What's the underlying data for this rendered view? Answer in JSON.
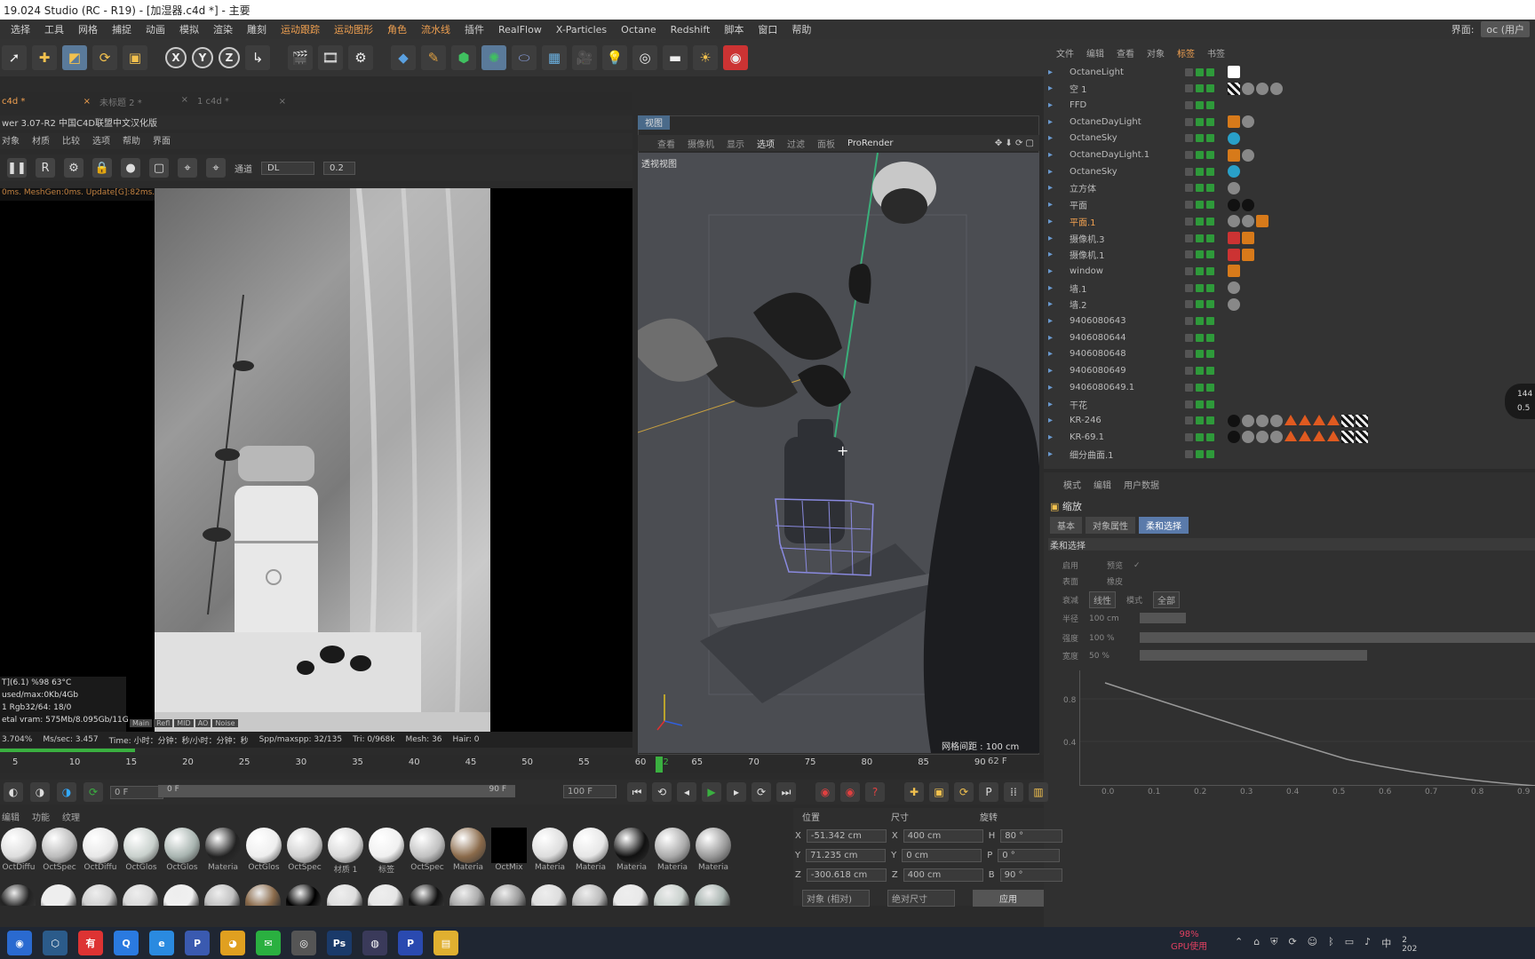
{
  "window": {
    "title": "19.024 Studio (RC - R19) - [加湿器.c4d *] - 主要"
  },
  "menu": {
    "items": [
      "选择",
      "工具",
      "网格",
      "捕捉",
      "动画",
      "模拟",
      "渲染",
      "雕刻",
      "运动跟踪",
      "运动图形",
      "角色",
      "流水线",
      "插件",
      "RealFlow",
      "X-Particles",
      "Octane",
      "Redshift",
      "脚本",
      "窗口",
      "帮助"
    ],
    "right_label": "界面:",
    "right_value": "oc (用户"
  },
  "tabs": [
    {
      "label": "c4d *"
    },
    {
      "label": "未标题 2 *"
    },
    {
      "label": "1 c4d *"
    }
  ],
  "live_viewer": {
    "title": "wer 3.07-R2 中国C4D联盟中文汉化版",
    "menu": [
      "对象",
      "材质",
      "比较",
      "选项",
      "帮助",
      "界面"
    ],
    "channel_label": "通道",
    "channel_value": "DL",
    "channel_amount": "0.2",
    "status_line": "0ms. MeshGen:0ms. Update[G]:82ms. Nodes:4? Moves:8? Matmove:0(0)",
    "info": [
      "T](6.1)      %98    63°C",
      "used/max:0Kb/4Gb",
      "1           Rgb32/64: 18/0",
      "etal vram: 575Mb/8.095Gb/11G"
    ],
    "tabs": [
      "Main",
      "Refl",
      "MID",
      "AO",
      "Noise"
    ],
    "footer": {
      "progress": "3.704%",
      "ms_sec": "Ms/sec: 3.457",
      "time": "Time: 小时：分钟：秒/小时：分钟：秒",
      "spp": "Spp/maxspp: 32/135",
      "tri": "Tri: 0/968k",
      "mesh": "Mesh: 36",
      "hair": "Hair: 0"
    }
  },
  "viewport": {
    "header": "视图",
    "menu": [
      "查看",
      "摄像机",
      "显示",
      "选项",
      "过滤",
      "面板",
      "ProRender"
    ],
    "label": "透视视图",
    "grid_spacing": "网格间距 : 100 cm"
  },
  "object_manager": {
    "menu": [
      "文件",
      "编辑",
      "查看",
      "对象",
      "标签",
      "书签"
    ],
    "objects": [
      {
        "name": "OctaneLight",
        "hl": false,
        "tags": [
          "w"
        ]
      },
      {
        "name": "空 1",
        "hl": false,
        "tags": [
          "ck",
          "s",
          "s",
          "s"
        ]
      },
      {
        "name": "FFD",
        "hl": false,
        "tags": []
      },
      {
        "name": "OctaneDayLight",
        "hl": false,
        "tags": [
          "o",
          "s"
        ]
      },
      {
        "name": "OctaneSky",
        "hl": false,
        "tags": [
          "cy"
        ]
      },
      {
        "name": "OctaneDayLight.1",
        "hl": false,
        "tags": [
          "o",
          "s"
        ]
      },
      {
        "name": "OctaneSky",
        "hl": false,
        "tags": [
          "cy"
        ]
      },
      {
        "name": "立方体",
        "hl": false,
        "tags": [
          "s"
        ]
      },
      {
        "name": "平面",
        "hl": false,
        "tags": [
          "b",
          "b"
        ]
      },
      {
        "name": "平面.1",
        "hl": true,
        "tags": [
          "s",
          "s",
          "o"
        ]
      },
      {
        "name": "摄像机.3",
        "hl": false,
        "tags": [
          "ri",
          "o"
        ]
      },
      {
        "name": "摄像机.1",
        "hl": false,
        "tags": [
          "ri",
          "o"
        ]
      },
      {
        "name": "window",
        "hl": false,
        "tags": [
          "o"
        ]
      },
      {
        "name": "墙.1",
        "hl": false,
        "tags": [
          "s"
        ]
      },
      {
        "name": "墙.2",
        "hl": false,
        "tags": [
          "s"
        ]
      },
      {
        "name": "9406080643",
        "hl": false,
        "tags": []
      },
      {
        "name": "9406080644",
        "hl": false,
        "tags": []
      },
      {
        "name": "9406080648",
        "hl": false,
        "tags": []
      },
      {
        "name": "9406080649",
        "hl": false,
        "tags": []
      },
      {
        "name": "9406080649.1",
        "hl": false,
        "tags": []
      },
      {
        "name": "干花",
        "hl": false,
        "tags": []
      },
      {
        "name": "KR-246",
        "hl": false,
        "tags": [
          "b",
          "s",
          "s",
          "s",
          "tri",
          "tri",
          "tri",
          "tri",
          "ck",
          "ck"
        ]
      },
      {
        "name": "KR-69.1",
        "hl": false,
        "tags": [
          "b",
          "s",
          "s",
          "s",
          "tri",
          "tri",
          "tri",
          "tri",
          "ck",
          "ck"
        ]
      },
      {
        "name": "细分曲面.1",
        "hl": false,
        "tags": []
      }
    ]
  },
  "attributes": {
    "menu": [
      "模式",
      "编辑",
      "用户数据"
    ],
    "title": "缩放",
    "tabs": [
      "基本",
      "对象属性",
      "柔和选择"
    ],
    "section": "柔和选择",
    "rows": [
      {
        "a": "启用",
        "b": "预览"
      },
      {
        "a": "表面",
        "b": "橡皮"
      },
      {
        "a": "限制",
        "b": ""
      },
      {
        "a": "衰减",
        "b": "线性"
      },
      {
        "a": "半径",
        "b": "100 cm"
      },
      {
        "a": "强度",
        "b": "100 %"
      },
      {
        "a": "宽度",
        "b": "50 %"
      }
    ],
    "mode_label": "模式",
    "mode_value": "全部",
    "graph_y": [
      "0.8",
      "0.4"
    ],
    "graph_x": [
      "0.0",
      "0.1",
      "0.2",
      "0.3",
      "0.4",
      "0.5",
      "0.6",
      "0.7",
      "0.8",
      "0.9"
    ]
  },
  "timeline": {
    "ticks": [
      "5",
      "10",
      "15",
      "20",
      "25",
      "30",
      "35",
      "40",
      "45",
      "50",
      "55",
      "60",
      "62",
      "65",
      "70",
      "75",
      "80",
      "85",
      "90"
    ],
    "end_label": "62 F",
    "current": "0 F",
    "range_start": "0 F",
    "range_end": "90 F",
    "max": "100 F"
  },
  "materials": {
    "menu": [
      "编辑",
      "功能",
      "纹理"
    ],
    "names": [
      "OctDiffu",
      "OctSpec",
      "OctDiffu",
      "OctGlos",
      "OctGlos",
      "Materia",
      "OctGlos",
      "OctSpec",
      "材质 1",
      "标签",
      "OctSpec",
      "Materia",
      "OctMix",
      "Materia",
      "Materia",
      "Materia",
      "Materia",
      "Materia"
    ]
  },
  "coords": {
    "headers": [
      "位置",
      "尺寸",
      "旋转"
    ],
    "rows": [
      {
        "l": "X",
        "v1": "-51.342 cm",
        "l2": "X",
        "v2": "400 cm",
        "l3": "H",
        "v3": "80 °"
      },
      {
        "l": "Y",
        "v1": "71.235 cm",
        "l2": "Y",
        "v2": "0 cm",
        "l3": "P",
        "v3": "0 °"
      },
      {
        "l": "Z",
        "v1": "-300.618 cm",
        "l2": "Z",
        "v2": "400 cm",
        "l3": "B",
        "v3": "90 °"
      }
    ],
    "mode1": "对象 (相对)",
    "mode2": "绝对尺寸",
    "apply": "应用"
  },
  "taskbar": {
    "gpu_pct": "98%",
    "gpu_label": "GPU使用",
    "ime": "中",
    "year": "202",
    "hour": "2"
  },
  "bubble": {
    "a": "144",
    "b": "0.5"
  }
}
